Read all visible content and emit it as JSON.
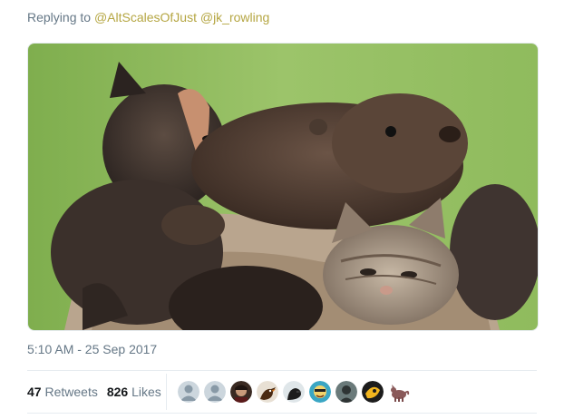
{
  "reply": {
    "prefix": "Replying to",
    "mention_1": "@AltScalesOfJust",
    "mention_2": "@jk_rowling"
  },
  "media": {
    "icon": "photo-kittens-and-otter"
  },
  "tweet": {
    "timestamp": "5:10 AM - 25 Sep 2017"
  },
  "stats": {
    "retweets_count": "47",
    "retweets_label": "Retweets",
    "likes_count": "826",
    "likes_label": "Likes"
  },
  "avatars": [
    {
      "icon": "default-avatar-icon"
    },
    {
      "icon": "default-avatar-icon"
    },
    {
      "icon": "person-avatar-icon"
    },
    {
      "icon": "bird-avatar-icon"
    },
    {
      "icon": "bird-avatar-icon"
    },
    {
      "icon": "cartoon-avatar-icon"
    },
    {
      "icon": "person-avatar-icon"
    },
    {
      "icon": "emblem-avatar-icon"
    },
    {
      "icon": "animal-avatar-icon"
    }
  ],
  "colors": {
    "mention": "#b5a642",
    "secondary_text": "#657786",
    "primary_text": "#14171a",
    "border": "#e6ecf0"
  }
}
